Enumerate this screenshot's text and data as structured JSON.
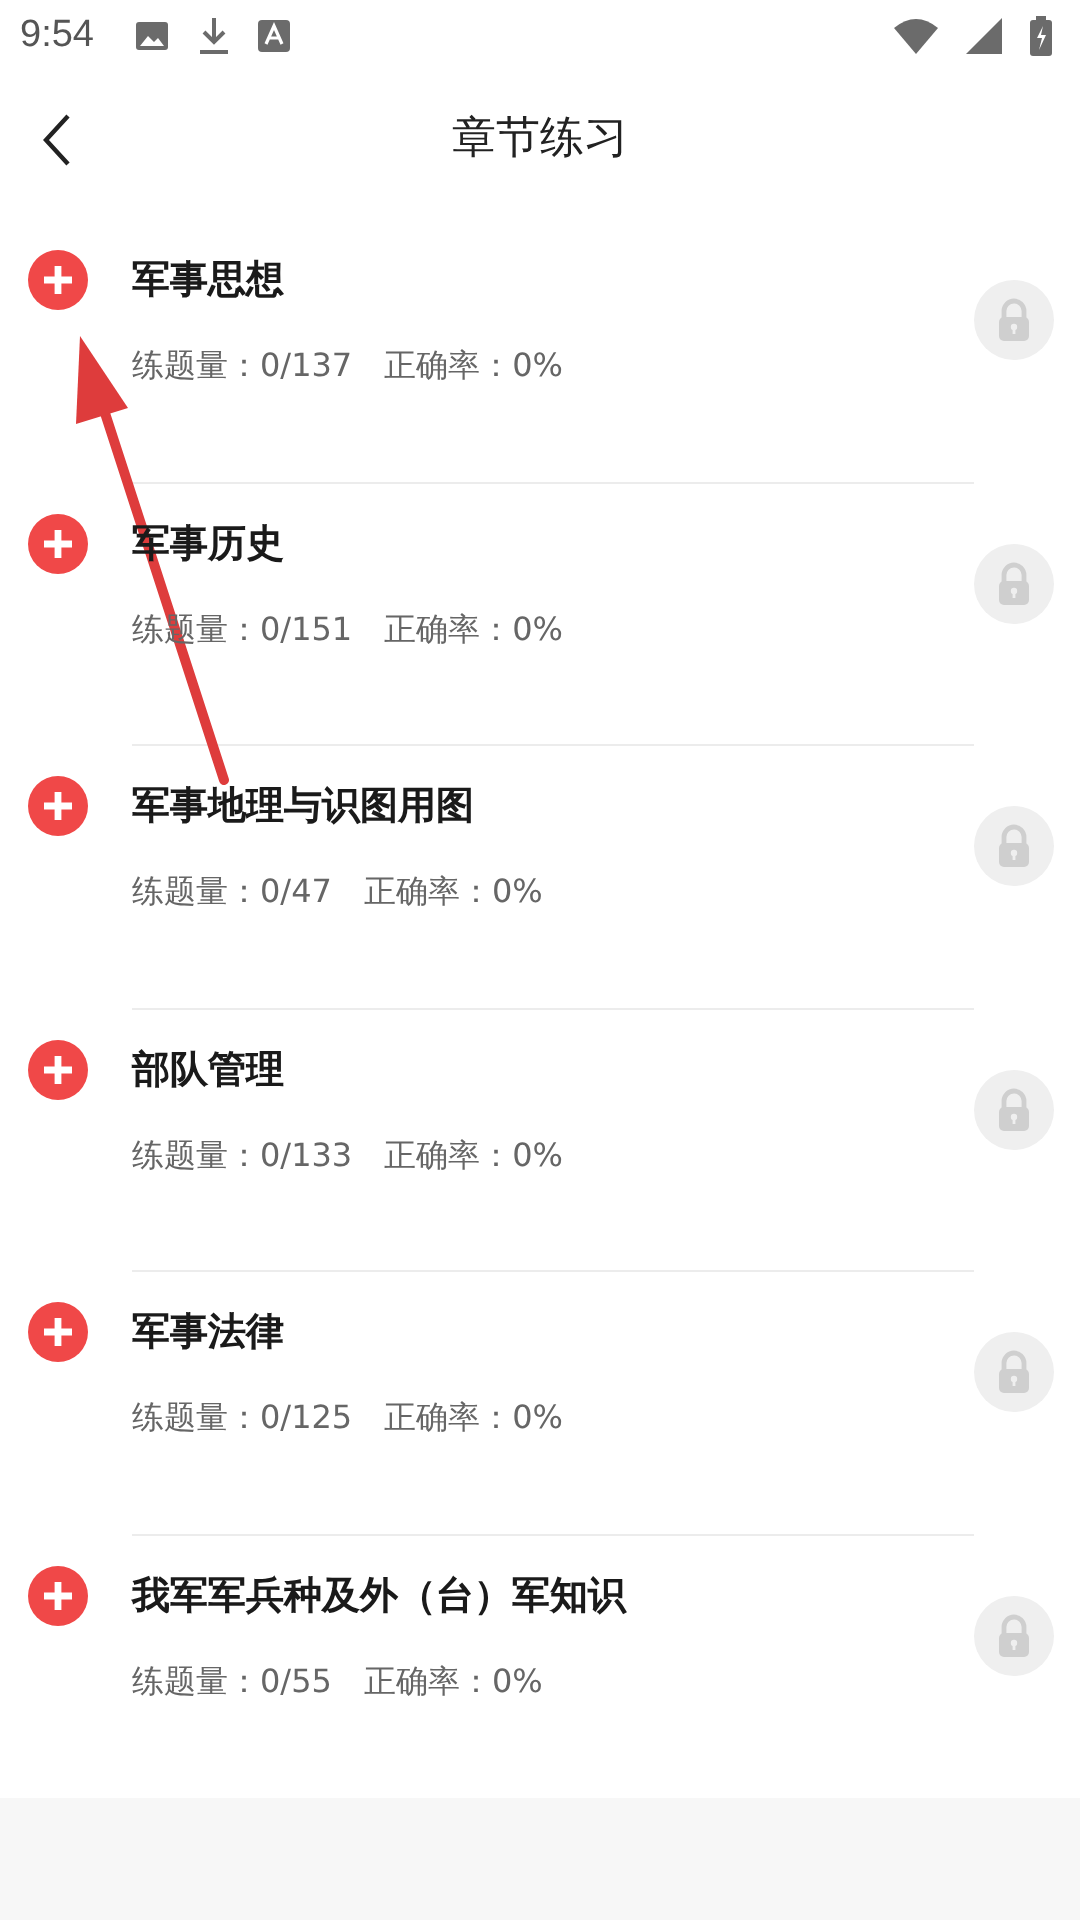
{
  "status_bar": {
    "time": "9:54"
  },
  "header": {
    "title": "章节练习"
  },
  "chapters": [
    {
      "title": "军事思想",
      "count": "练题量：0/137",
      "accuracy": "正确率：0%",
      "locked": true
    },
    {
      "title": "军事历史",
      "count": "练题量：0/151",
      "accuracy": "正确率：0%",
      "locked": true
    },
    {
      "title": "军事地理与识图用图",
      "count": "练题量：0/47",
      "accuracy": "正确率：0%",
      "locked": true
    },
    {
      "title": "部队管理",
      "count": "练题量：0/133",
      "accuracy": "正确率：0%",
      "locked": true
    },
    {
      "title": "军事法律",
      "count": "练题量：0/125",
      "accuracy": "正确率：0%",
      "locked": true
    },
    {
      "title": "我军军兵种及外（台）军知识",
      "count": "练题量：0/55",
      "accuracy": "正确率：0%",
      "locked": true
    }
  ]
}
